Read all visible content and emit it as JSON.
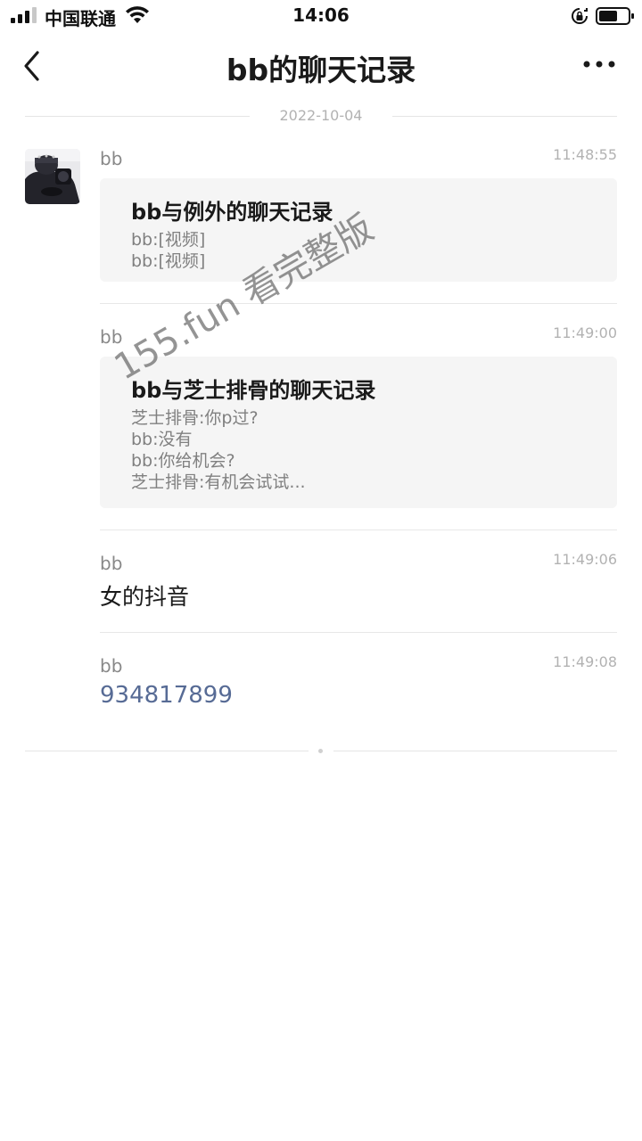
{
  "status_bar": {
    "carrier": "中国联通",
    "time": "14:06",
    "icons": [
      "signal-icon",
      "wifi-icon",
      "orientation-lock-icon",
      "battery-icon"
    ]
  },
  "nav": {
    "title": "bb的聊天记录",
    "icons": [
      "back-chevron-icon",
      "more-dots-icon"
    ]
  },
  "date_divider": "2022-10-04",
  "messages": [
    {
      "sender": "bb",
      "time": "11:48:55",
      "type": "chat_record",
      "card_title": "bb与例外的聊天记录",
      "lines": [
        "bb:[视频]",
        "bb:[视频]"
      ]
    },
    {
      "sender": "bb",
      "time": "11:49:00",
      "type": "chat_record",
      "card_title": "bb与芝士排骨的聊天记录",
      "lines": [
        "芝士排骨:你p过?",
        "bb:没有",
        "bb:你给机会?",
        "芝士排骨:有机会试试..."
      ]
    },
    {
      "sender": "bb",
      "time": "11:49:06",
      "type": "text",
      "text": "女的抖音"
    },
    {
      "sender": "bb",
      "time": "11:49:08",
      "type": "link",
      "text": "934817899"
    }
  ],
  "watermark": "155.fun 看完整版",
  "colors": {
    "background": "#ffffff",
    "link": "#576b95",
    "card": "#f5f5f5",
    "meta": "#b2b2b2"
  }
}
